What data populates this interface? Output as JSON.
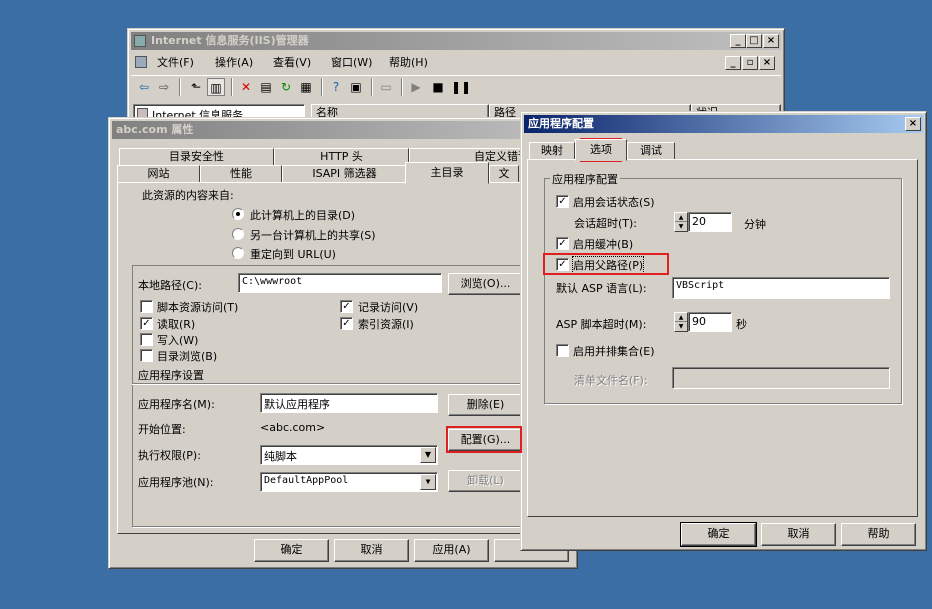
{
  "iis": {
    "title": "Internet 信息服务(IIS)管理器",
    "menu": [
      "文件(F)",
      "操作(A)",
      "查看(V)",
      "窗口(W)",
      "帮助(H)"
    ],
    "tree_root": "Internet 信息服务",
    "col_name": "名称",
    "col_path": "路径",
    "col_status": "状况"
  },
  "props": {
    "title": "abc.com 属性",
    "tabs_back": [
      "目录安全性",
      "HTTP 头",
      "自定义错误"
    ],
    "tabs_front": [
      "网站",
      "性能",
      "ISAPI 筛选器",
      "主目录",
      "文"
    ],
    "source_label": "此资源的内容来自:",
    "radios": [
      "此计算机上的目录(D)",
      "另一台计算机上的共享(S)",
      "重定向到 URL(U)"
    ],
    "local_path_label": "本地路径(C):",
    "local_path_value": "C:\\wwwroot",
    "browse": "浏览(O)...",
    "checks_left": [
      {
        "label": "脚本资源访问(T)",
        "checked": false
      },
      {
        "label": "读取(R)",
        "checked": true
      },
      {
        "label": "写入(W)",
        "checked": false
      },
      {
        "label": "目录浏览(B)",
        "checked": false
      }
    ],
    "checks_right": [
      {
        "label": "记录访问(V)",
        "checked": true
      },
      {
        "label": "索引资源(I)",
        "checked": true
      }
    ],
    "app_settings": "应用程序设置",
    "app_name_label": "应用程序名(M):",
    "app_name_value": "默认应用程序",
    "remove": "删除(E)",
    "start_label": "开始位置:",
    "start_value": "<abc.com>",
    "config": "配置(G)...",
    "exec_label": "执行权限(P):",
    "exec_value": "纯脚本",
    "pool_label": "应用程序池(N):",
    "pool_value": "DefaultAppPool",
    "unload": "卸载(L)",
    "ok": "确定",
    "cancel": "取消",
    "apply": "应用(A)"
  },
  "cfg": {
    "title": "应用程序配置",
    "close": "×",
    "tabs": [
      "映射",
      "选项",
      "调试"
    ],
    "group": "应用程序配置",
    "session_state": "启用会话状态(S)",
    "session_timeout_label": "会话超时(T):",
    "session_timeout": "20",
    "minutes": "分钟",
    "buffer": "启用缓冲(B)",
    "parent_paths": "启用父路径(P)",
    "lang_label": "默认 ASP 语言(L):",
    "lang_value": "VBScript",
    "asp_timeout_label": "ASP 脚本超时(M):",
    "asp_timeout": "90",
    "seconds": "秒",
    "side_by_side": "启用并排集合(E)",
    "manifest_label": "清单文件名(F):",
    "ok": "确定",
    "cancel": "取消",
    "help": "帮助"
  },
  "colors": {
    "desktop": "#3a6ea5",
    "face": "#d4d0c8",
    "title_active": "#0a246a",
    "highlight": "#e02020"
  }
}
